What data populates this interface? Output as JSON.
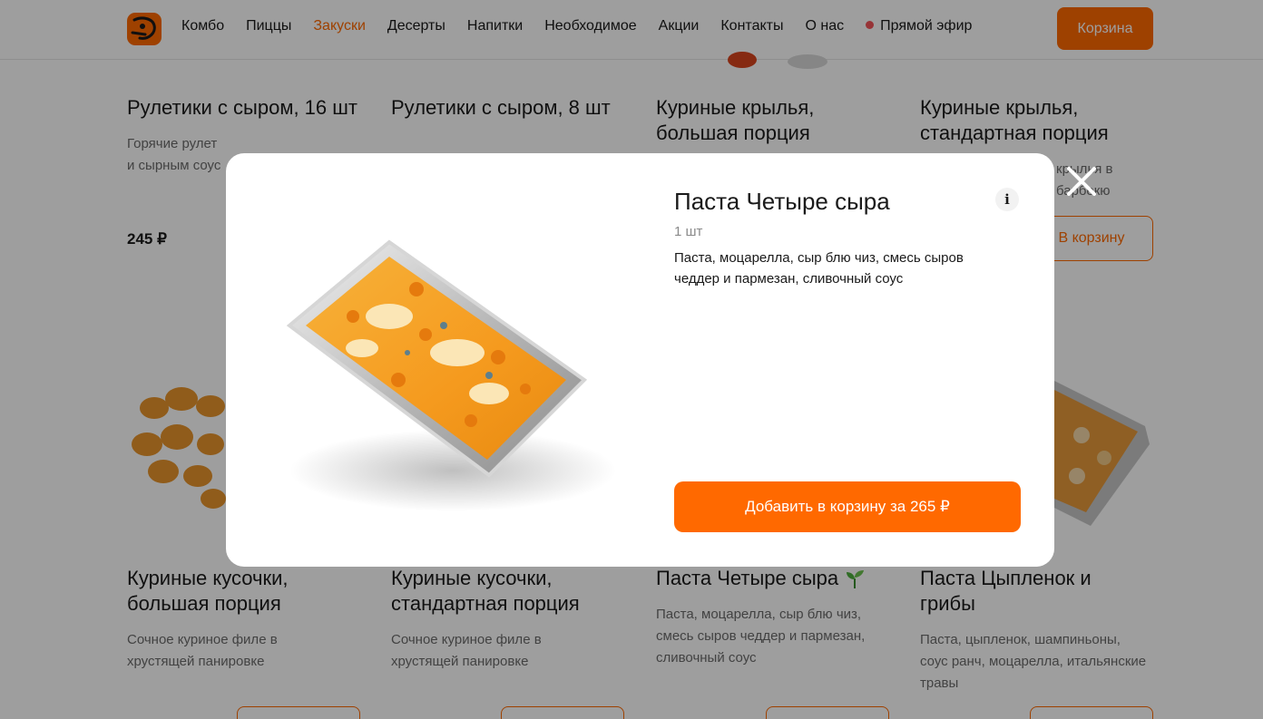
{
  "header": {
    "nav": [
      "Комбо",
      "Пиццы",
      "Закуски",
      "Десерты",
      "Напитки",
      "Необходимое",
      "Акции",
      "Контакты",
      "О нас",
      "Прямой эфир"
    ],
    "active_nav": "Закуски",
    "cart_label": "Корзина"
  },
  "products": {
    "row1": [
      {
        "title": "Рулетики с сыром, 16 шт",
        "desc": "Горячие рулет и сырным соус",
        "price": "245 ₽"
      },
      {
        "title": "Рулетики с сыром, 8 шт"
      },
      {
        "title": "Куриные крылья, большая порция"
      },
      {
        "title": "Куриные крылья, стандартная порция",
        "desc": "крылья в барбекю",
        "button": "В корзину"
      }
    ],
    "row2": [
      {
        "title": "Куриные кусочки, большая порция",
        "desc": "Сочное куриное филе в хрустящей панировке"
      },
      {
        "title": "Куриные кусочки, стандартная порция",
        "desc": "Сочное куриное филе в хрустящей панировке"
      },
      {
        "title": "Паста Четыре сыра",
        "desc": "Паста, моцарелла, сыр блю чиз, смесь сыров чеддер и пармезан, сливочный соус",
        "badge_icon": "sprout-icon"
      },
      {
        "title": "Паста Цыпленок и грибы",
        "desc": "Паста, цыпленок, шампиньоны, соус ранч, моцарелла, итальянские травы"
      }
    ]
  },
  "modal": {
    "title": "Паста Четыре сыра",
    "portion": "1 шт",
    "description": "Паста, моцарелла, сыр блю чиз, смесь сыров чеддер и пармезан, сливочный соус",
    "info_label": "i",
    "add_button": "Добавить в корзину за 265 ₽"
  },
  "colors": {
    "accent": "#ff6900",
    "live_dot": "#f4555a",
    "overlay": "rgba(0,0,0,0.38)"
  }
}
